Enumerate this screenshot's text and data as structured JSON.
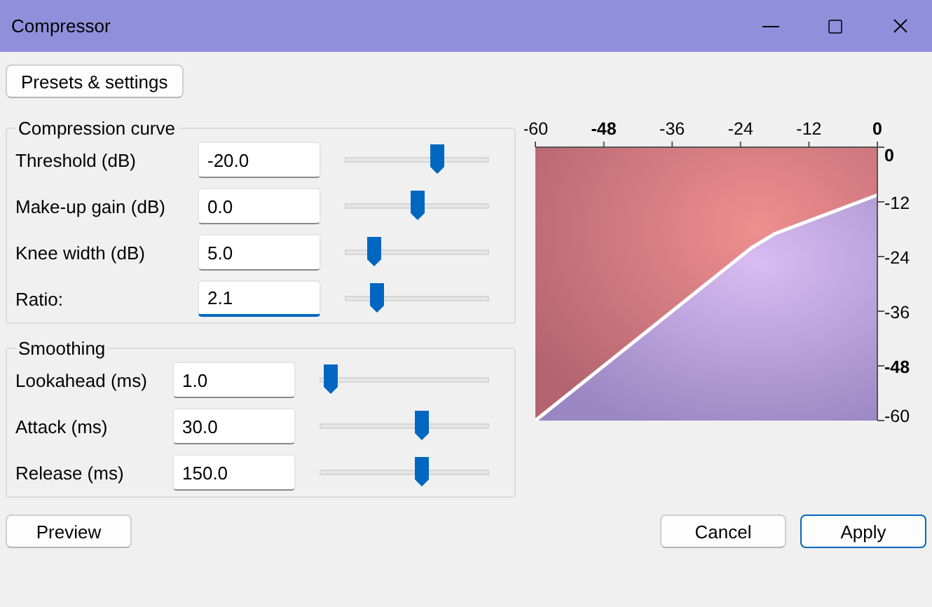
{
  "window": {
    "title": "Compressor"
  },
  "presets_button": "Presets & settings",
  "groups": [
    {
      "title": "Compression curve",
      "rows": [
        {
          "label": "Threshold (dB)",
          "value": "-20.0",
          "focused": false,
          "level": 0.64
        },
        {
          "label": "Make-up gain (dB)",
          "value": "0.0",
          "focused": false,
          "level": 0.5
        },
        {
          "label": "Knee width (dB)",
          "value": "5.0",
          "focused": false,
          "level": 0.2
        },
        {
          "label": "Ratio:",
          "value": "2.1",
          "focused": true,
          "level": 0.22
        }
      ]
    },
    {
      "title": "Smoothing",
      "rows": [
        {
          "label": "Lookahead (ms)",
          "value": "1.0",
          "focused": false,
          "level": 0.07
        },
        {
          "label": "Attack (ms)",
          "value": "30.0",
          "focused": false,
          "level": 0.6
        },
        {
          "label": "Release (ms)",
          "value": "150.0",
          "focused": false,
          "level": 0.6
        }
      ]
    }
  ],
  "chart_data": {
    "type": "line",
    "x": [
      -60,
      -22,
      -18,
      0
    ],
    "series": [
      {
        "color": "#ffffff",
        "values": [
          -60,
          -22,
          -19,
          -10.5
        ]
      }
    ],
    "xlim": [
      -60,
      0
    ],
    "ylim": [
      -60,
      0
    ],
    "xticks": [
      -60,
      -48,
      -36,
      -24,
      -12,
      0
    ],
    "yticks": [
      0,
      -12,
      -24,
      -36,
      -48,
      -60
    ]
  },
  "buttons": [
    {
      "label": "Preview",
      "primary": false
    },
    {
      "label": "Cancel",
      "primary": false
    },
    {
      "label": "Apply",
      "primary": true
    }
  ]
}
